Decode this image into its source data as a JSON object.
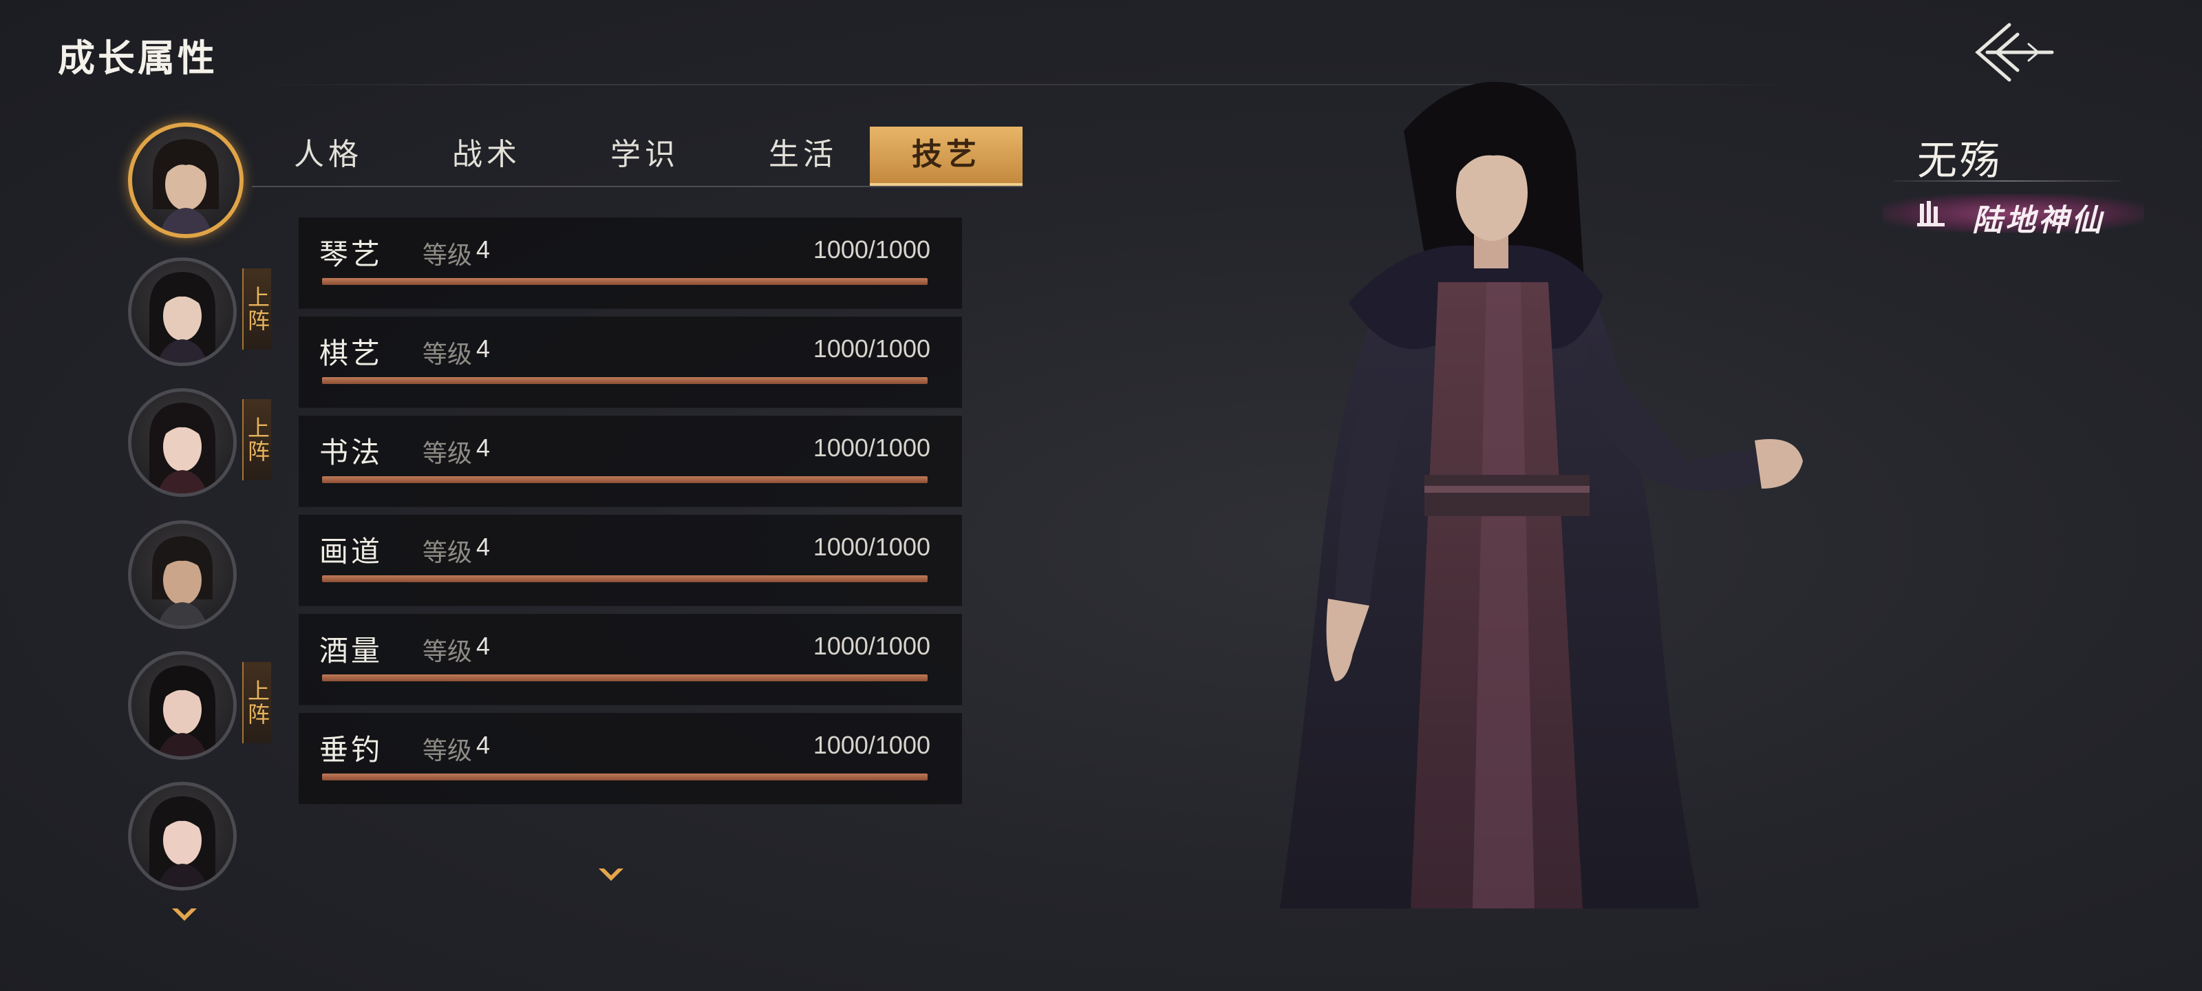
{
  "header": {
    "title": "成长属性"
  },
  "roster": {
    "deploy_label": "上阵",
    "members": [
      {
        "selected": true,
        "deployed": false
      },
      {
        "selected": false,
        "deployed": true
      },
      {
        "selected": false,
        "deployed": true
      },
      {
        "selected": false,
        "deployed": false
      },
      {
        "selected": false,
        "deployed": true
      },
      {
        "selected": false,
        "deployed": false
      }
    ]
  },
  "tabs": [
    {
      "label": "人格",
      "active": false
    },
    {
      "label": "战术",
      "active": false
    },
    {
      "label": "学识",
      "active": false
    },
    {
      "label": "生活",
      "active": false
    },
    {
      "label": "技艺",
      "active": true
    }
  ],
  "skills": {
    "level_label": "等级",
    "items": [
      {
        "name": "琴艺",
        "level": "4",
        "progress": "1000/1000",
        "fill": 1.0
      },
      {
        "name": "棋艺",
        "level": "4",
        "progress": "1000/1000",
        "fill": 1.0
      },
      {
        "name": "书法",
        "level": "4",
        "progress": "1000/1000",
        "fill": 1.0
      },
      {
        "name": "画道",
        "level": "4",
        "progress": "1000/1000",
        "fill": 1.0
      },
      {
        "name": "酒量",
        "level": "4",
        "progress": "1000/1000",
        "fill": 1.0
      },
      {
        "name": "垂钓",
        "level": "4",
        "progress": "1000/1000",
        "fill": 1.0
      }
    ]
  },
  "character": {
    "name": "无殇",
    "realm": "陆地神仙"
  },
  "colors": {
    "accent_gold": "#e0a447",
    "progress_bar": "#b06e4c",
    "realm_glow": "#aa4682"
  }
}
